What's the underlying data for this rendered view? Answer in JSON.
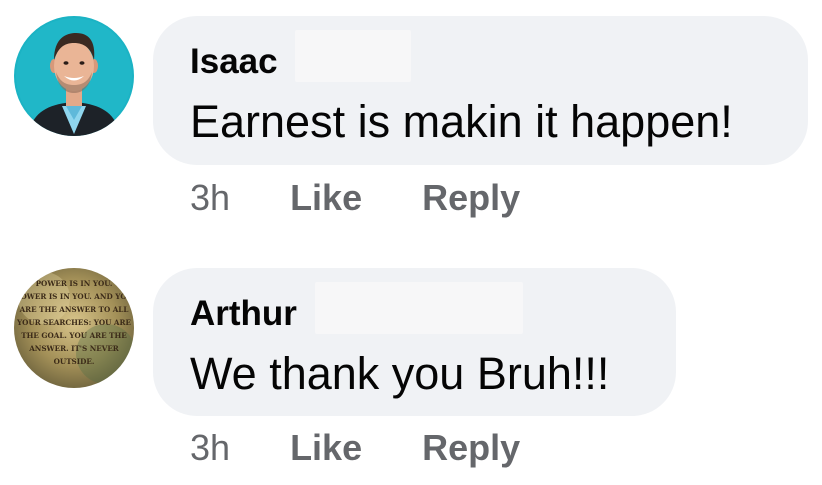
{
  "comments": [
    {
      "author": "Isaac",
      "text": "Earnest is makin it happen!",
      "time": "3h",
      "like_label": "Like",
      "reply_label": "Reply"
    },
    {
      "author": "Arthur",
      "text": "We thank you Bruh!!!",
      "time": "3h",
      "like_label": "Like",
      "reply_label": "Reply",
      "avatar_quote_lines": [
        "POWER IS IN YOU.",
        "POWER IS IN YOU. AND YOU",
        "ARE THE ANSWER TO ALL",
        "YOUR SEARCHES: YOU ARE",
        "THE GOAL. YOU ARE THE",
        "ANSWER. IT'S NEVER",
        "OUTSIDE."
      ]
    }
  ],
  "colors": {
    "bubble_bg": "#f0f2f5",
    "text": "#050505",
    "meta": "#65676b",
    "avatar1_bg": "#1bb3c4"
  }
}
